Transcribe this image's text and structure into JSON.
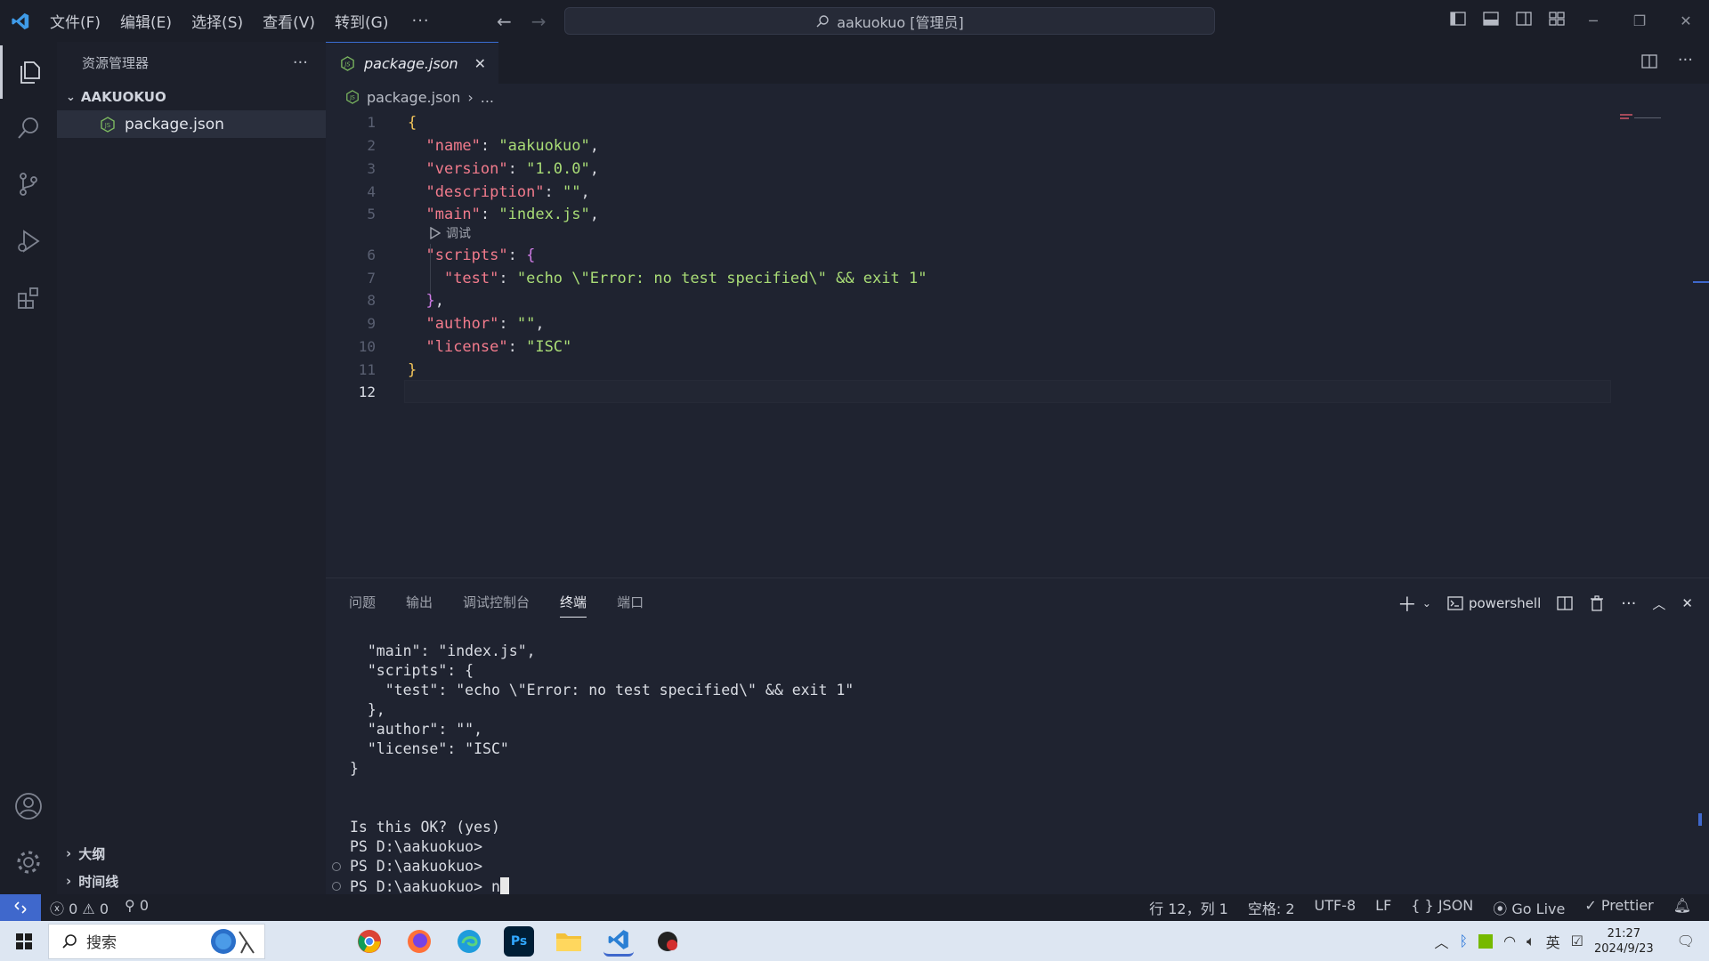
{
  "titlebar": {
    "menu": [
      "文件(F)",
      "编辑(E)",
      "选择(S)",
      "查看(V)",
      "转到(G)"
    ],
    "more": "···",
    "command_center": "aakuokuo [管理员]"
  },
  "sidebar": {
    "title": "资源管理器",
    "more": "···",
    "folder": "AAKUOKUO",
    "file": "package.json",
    "outline": "大纲",
    "timeline": "时间线"
  },
  "editor": {
    "tab_label": "package.json",
    "breadcrumb_file": "package.json",
    "breadcrumb_more": "...",
    "codelens": "调试",
    "line_numbers": [
      "1",
      "2",
      "3",
      "4",
      "5",
      "6",
      "7",
      "8",
      "9",
      "10",
      "11",
      "12"
    ],
    "lines": {
      "l1_open": "{",
      "l2_key": "\"name\"",
      "l2_val": "\"aakuokuo\"",
      "l3_key": "\"version\"",
      "l3_val": "\"1.0.0\"",
      "l4_key": "\"description\"",
      "l4_val": "\"\"",
      "l5_key": "\"main\"",
      "l5_val": "\"index.js\"",
      "l6_key": "\"scripts\"",
      "l6_open": "{",
      "l7_key": "\"test\"",
      "l7_val": "\"echo \\\"Error: no test specified\\\" && exit 1\"",
      "l8_close": "}",
      "l9_key": "\"author\"",
      "l9_val": "\"\"",
      "l10_key": "\"license\"",
      "l10_val": "\"ISC\"",
      "l11_close": "}"
    }
  },
  "panel": {
    "tabs": [
      "问题",
      "输出",
      "调试控制台",
      "终端",
      "端口"
    ],
    "active_tab": "终端",
    "shell": "powershell",
    "terminal_lines": [
      "  \"main\": \"index.js\",",
      "  \"scripts\": {",
      "    \"test\": \"echo \\\"Error: no test specified\\\" && exit 1\"",
      "  },",
      "  \"author\": \"\",",
      "  \"license\": \"ISC\"",
      "}",
      "",
      "",
      "Is this OK? (yes)",
      "PS D:\\aakuokuo>",
      "PS D:\\aakuokuo>",
      "PS D:\\aakuokuo> n"
    ]
  },
  "statusbar": {
    "errors": "0",
    "warnings": "0",
    "ports": "0",
    "position": "行 12，列 1",
    "indent": "空格: 2",
    "encoding": "UTF-8",
    "eol": "LF",
    "language": "JSON",
    "golive": "Go Live",
    "prettier": "Prettier"
  },
  "taskbar": {
    "search": "搜索",
    "time": "21:27",
    "date": "2024/9/23",
    "ime": "英"
  },
  "colors": {
    "accent": "#3f68cc",
    "json_key": "#f27b8c",
    "json_string": "#a9dc76",
    "bracket_outer": "#f0c35a",
    "bracket_inner": "#d07ce6"
  }
}
